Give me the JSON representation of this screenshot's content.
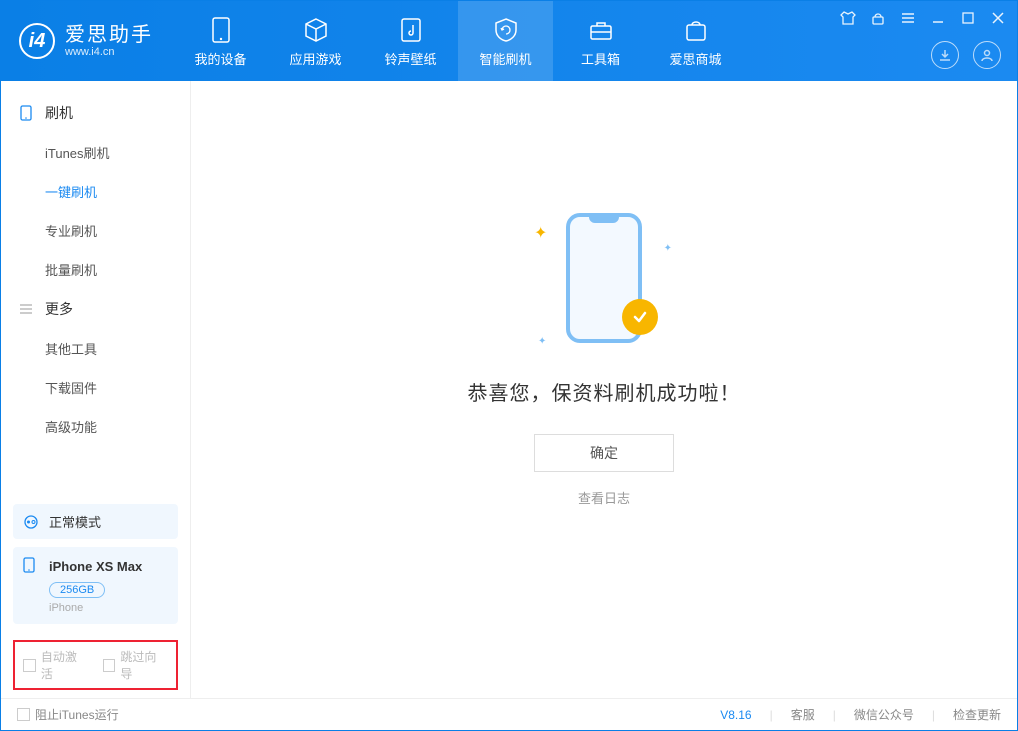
{
  "app": {
    "name": "爱思助手",
    "url": "www.i4.cn"
  },
  "nav": {
    "tabs": [
      {
        "label": "我的设备"
      },
      {
        "label": "应用游戏"
      },
      {
        "label": "铃声壁纸"
      },
      {
        "label": "智能刷机"
      },
      {
        "label": "工具箱"
      },
      {
        "label": "爱思商城"
      }
    ]
  },
  "sidebar": {
    "section1": {
      "title": "刷机",
      "items": [
        "iTunes刷机",
        "一键刷机",
        "专业刷机",
        "批量刷机"
      ]
    },
    "section2": {
      "title": "更多",
      "items": [
        "其他工具",
        "下载固件",
        "高级功能"
      ]
    },
    "mode": "正常模式",
    "device": {
      "name": "iPhone XS Max",
      "capacity": "256GB",
      "type": "iPhone"
    },
    "checkboxes": {
      "auto_activate": "自动激活",
      "skip_guide": "跳过向导"
    }
  },
  "main": {
    "success_text": "恭喜您，保资料刷机成功啦！",
    "confirm_button": "确定",
    "view_log": "查看日志"
  },
  "status": {
    "block_itunes": "阻止iTunes运行",
    "version": "V8.16",
    "links": [
      "客服",
      "微信公众号",
      "检查更新"
    ]
  }
}
